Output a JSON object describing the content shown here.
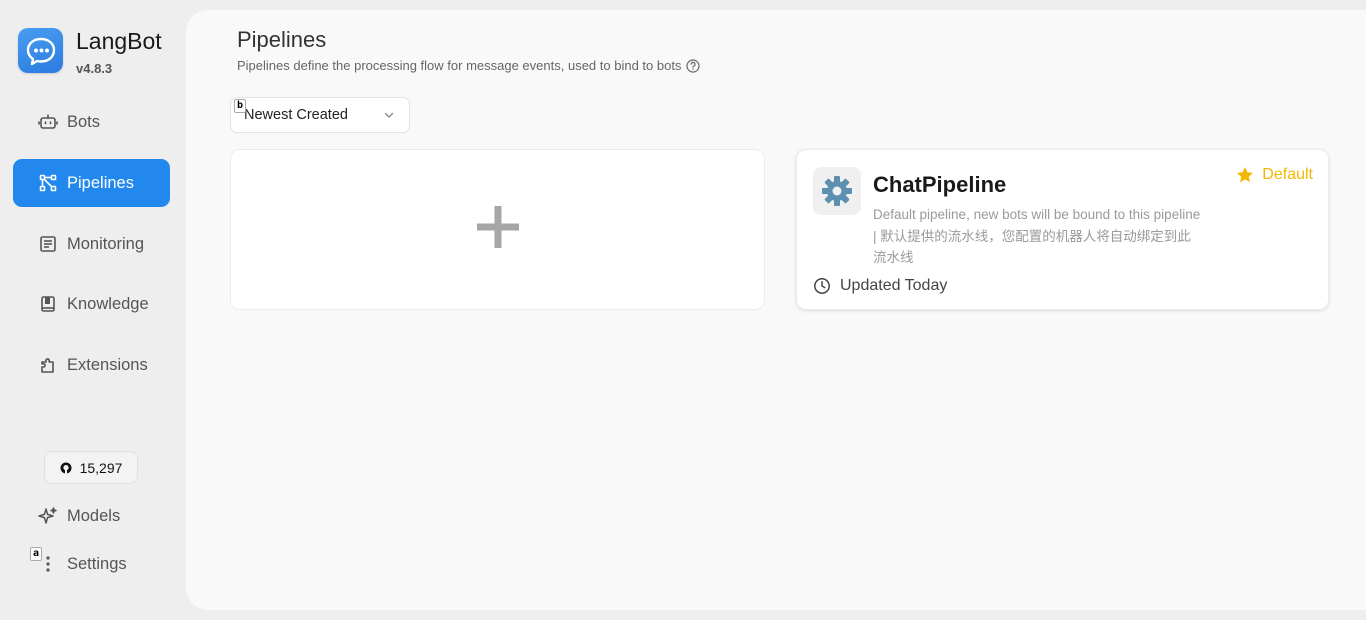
{
  "brand": {
    "name": "LangBot",
    "version": "v4.8.3"
  },
  "nav": {
    "bots": "Bots",
    "pipelines": "Pipelines",
    "monitoring": "Monitoring",
    "knowledge": "Knowledge",
    "extensions": "Extensions",
    "models": "Models",
    "settings": "Settings"
  },
  "github": {
    "stars": "15,297"
  },
  "tags": {
    "a": "a",
    "b": "b"
  },
  "page": {
    "title": "Pipelines",
    "subtitle": "Pipelines define the processing flow for message events, used to bind to bots"
  },
  "sort": {
    "selected": "Newest Created"
  },
  "add_card": {
    "icon": "plus-icon"
  },
  "pipeline": {
    "name": "ChatPipeline",
    "description": "Default pipeline, new bots will be bound to this pipeline | 默认提供的流水线，您配置的机器人将自动绑定到此流水线",
    "badge": "Default",
    "updated": "Updated Today",
    "icon": "⚙️"
  },
  "colors": {
    "accent": "#2288ee",
    "default_badge": "#f2b705",
    "logo": "#3a8ee8"
  }
}
